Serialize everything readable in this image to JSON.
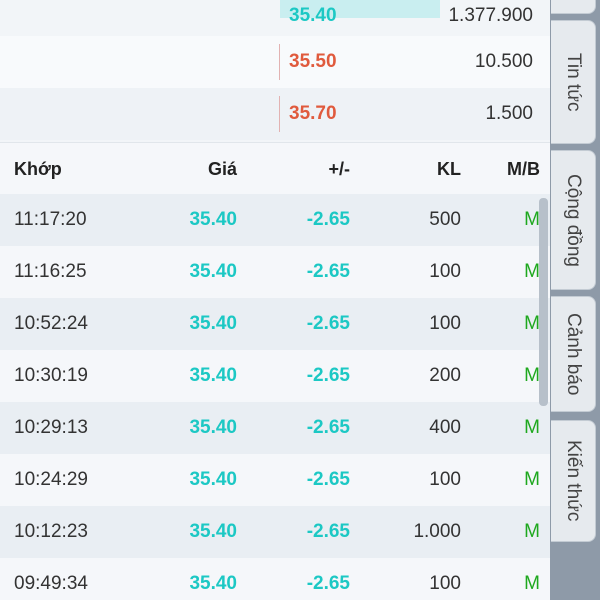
{
  "order_book": [
    {
      "price": "35.40",
      "volume": "1.377.900",
      "price_color": "#1cc8c4",
      "highlighted": true
    },
    {
      "price": "35.50",
      "volume": "10.500",
      "price_color": "#e05a3d",
      "highlighted": false
    },
    {
      "price": "35.70",
      "volume": "1.500",
      "price_color": "#e05a3d",
      "highlighted": false
    }
  ],
  "trades_header": {
    "time": "Khớp",
    "price": "Giá",
    "change": "+/-",
    "volume": "KL",
    "side": "M/B"
  },
  "trades": [
    {
      "time": "11:17:20",
      "price": "35.40",
      "change": "-2.65",
      "volume": "500",
      "side": "M"
    },
    {
      "time": "11:16:25",
      "price": "35.40",
      "change": "-2.65",
      "volume": "100",
      "side": "M"
    },
    {
      "time": "10:52:24",
      "price": "35.40",
      "change": "-2.65",
      "volume": "100",
      "side": "M"
    },
    {
      "time": "10:30:19",
      "price": "35.40",
      "change": "-2.65",
      "volume": "200",
      "side": "M"
    },
    {
      "time": "10:29:13",
      "price": "35.40",
      "change": "-2.65",
      "volume": "400",
      "side": "M"
    },
    {
      "time": "10:24:29",
      "price": "35.40",
      "change": "-2.65",
      "volume": "100",
      "side": "M"
    },
    {
      "time": "10:12:23",
      "price": "35.40",
      "change": "-2.65",
      "volume": "1.000",
      "side": "M"
    },
    {
      "time": "09:49:34",
      "price": "35.40",
      "change": "-2.65",
      "volume": "100",
      "side": "M"
    }
  ],
  "tabs": [
    {
      "label": "Tin tức"
    },
    {
      "label": "Cộng đồng"
    },
    {
      "label": "Cảnh báo"
    },
    {
      "label": "Kiến thức"
    }
  ],
  "colors": {
    "accent_teal": "#1cc8c4",
    "ask_red": "#e05a3d",
    "buy_green": "#1ea81e"
  }
}
